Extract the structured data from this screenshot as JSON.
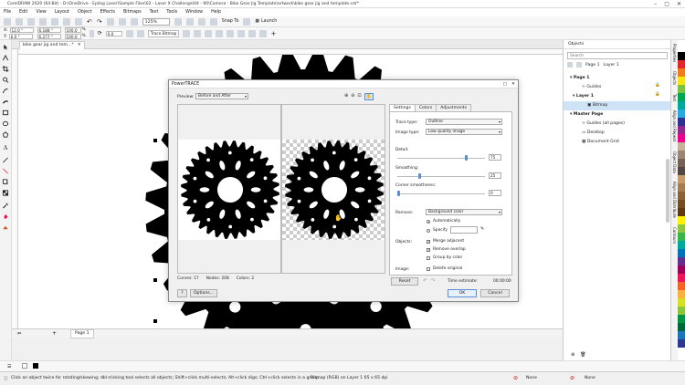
{
  "app": {
    "title": "CorelDRAW 2020 (64-Bit) - D:\\OneDrive - Epilog Laser\\Sample Files\\02 - Laser X Challenge\\04 - 90\\Camera - Bike Gear Jig Template\\artwork\\bike gear jig and template.cdr*"
  },
  "menu": [
    "File",
    "Edit",
    "View",
    "Layout",
    "Object",
    "Effects",
    "Bitmaps",
    "Text",
    "Tools",
    "Window",
    "Help"
  ],
  "toolbar": {
    "zoom": "125%",
    "snap_to": "Snap To",
    "launch": "Launch"
  },
  "propbar": {
    "x_label": "X:",
    "x_value": "12.0 \"",
    "y_label": "Y:",
    "y_value": "6.0 \"",
    "w_value": "6.188 \"",
    "h_value": "6.277 \"",
    "scale_w": "100.0",
    "scale_h": "100.0",
    "pct": "%",
    "angle": "0.0",
    "trace_bitmap": "Trace Bitmap"
  },
  "document": {
    "tab_name": "bike gear jig and tem...*",
    "page_tab": "Page 1"
  },
  "objects_panel": {
    "title": "Objects",
    "search_placeholder": "Search",
    "page1": "Page 1",
    "layer1_header": "Layer 1",
    "rows": [
      {
        "label": "Page 1"
      },
      {
        "label": "Guides"
      },
      {
        "label": "Layer 1"
      },
      {
        "label": "Bitmap"
      },
      {
        "label": "Master Page"
      },
      {
        "label": "Guides (all pages)"
      },
      {
        "label": "Desktop"
      },
      {
        "label": "Document Grid"
      }
    ]
  },
  "docker_tabs": [
    "Properties",
    "Objects",
    "Text",
    "Align and Repeat",
    "Object Data",
    "Align and Distribute",
    "Contours"
  ],
  "palette_colors": [
    "#ffffff",
    "#000000",
    "#e3262b",
    "#f07b1d",
    "#f7e514",
    "#7dc242",
    "#00a651",
    "#00a99d",
    "#29aae1",
    "#2e3192",
    "#92278f",
    "#ec008c",
    "#c7b299",
    "#998675",
    "#736357",
    "#534741",
    "#c69c6d",
    "#a67c52",
    "#8c6239",
    "#754c24",
    "#603913",
    "#fff200",
    "#8dc63f",
    "#39b54a",
    "#00a99d",
    "#0072bc",
    "#662d91",
    "#9e005d",
    "#ed145b",
    "#f26522",
    "#fbb040",
    "#d7df23",
    "#8cc63f",
    "#009444",
    "#006838",
    "#1c75bc",
    "#2b3990"
  ],
  "status": {
    "hint": "Click an object twice for rotating/skewing; dbl-clicking tool selects all objects; Shift+click multi-selects; Alt+click digs; Ctrl+click selects in a group",
    "object_info": "Bitmap (RGB) on Layer 1 65 x 65 dpi",
    "fill": "None",
    "outline": "None"
  },
  "powertrace": {
    "title": "PowerTRACE",
    "preview_label": "Preview:",
    "preview_value": "Before and After",
    "tabs": [
      "Settings",
      "Colors",
      "Adjustments"
    ],
    "trace_type_label": "Trace type:",
    "trace_type_value": "Outline",
    "image_type_label": "Image type:",
    "image_type_value": "Low quality image",
    "detail_label": "Detail:",
    "detail_value": "75",
    "smoothing_label": "Smoothing:",
    "smoothing_value": "25",
    "corner_label": "Corner smoothness:",
    "corner_value": "0",
    "remove_label": "Remove:",
    "remove_value": "Background color",
    "auto_label": "Automatically",
    "specify_label": "Specify",
    "objects_label": "Objects:",
    "merge_adjacent": "Merge adjacent",
    "remove_overlap": "Remove overlap",
    "group_by_color": "Group by color",
    "image_label": "Image:",
    "delete_original": "Delete original",
    "reset": "Reset",
    "time_estimate_label": "Time estimate:",
    "time_estimate_value": "00:00:00",
    "ok": "OK",
    "cancel": "Cancel",
    "help": "?",
    "options": "Options...",
    "curves_label": "Curves:",
    "curves_value": "17",
    "nodes_label": "Nodes:",
    "nodes_value": "208",
    "colors_label": "Colors:",
    "colors_value": "2",
    "detail_level": 0.8,
    "smoothing_level": 0.25,
    "corner_level": 0.0
  }
}
